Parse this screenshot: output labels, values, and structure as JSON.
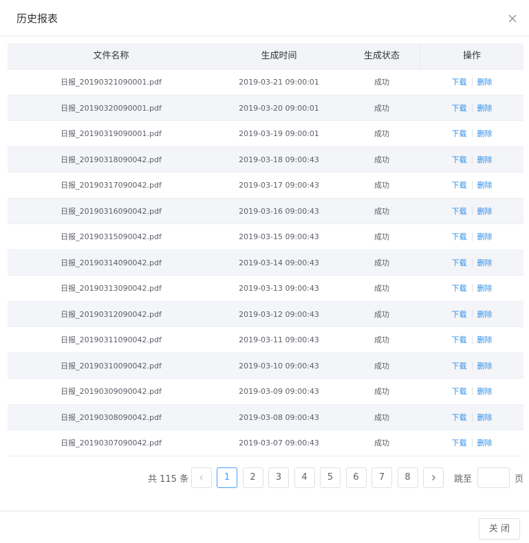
{
  "dialog": {
    "title": "历史报表",
    "close_button_label": "关 闭"
  },
  "table": {
    "columns": [
      "文件名称",
      "生成时间",
      "生成状态",
      "操作"
    ],
    "download_label": "下载",
    "delete_label": "删除",
    "rows": [
      {
        "name": "日报_20190321090001.pdf",
        "time": "2019-03-21 09:00:01",
        "status": "成功"
      },
      {
        "name": "日报_20190320090001.pdf",
        "time": "2019-03-20 09:00:01",
        "status": "成功"
      },
      {
        "name": "日报_20190319090001.pdf",
        "time": "2019-03-19 09:00:01",
        "status": "成功"
      },
      {
        "name": "日报_20190318090042.pdf",
        "time": "2019-03-18 09:00:43",
        "status": "成功"
      },
      {
        "name": "日报_20190317090042.pdf",
        "time": "2019-03-17 09:00:43",
        "status": "成功"
      },
      {
        "name": "日报_20190316090042.pdf",
        "time": "2019-03-16 09:00:43",
        "status": "成功"
      },
      {
        "name": "日报_20190315090042.pdf",
        "time": "2019-03-15 09:00:43",
        "status": "成功"
      },
      {
        "name": "日报_20190314090042.pdf",
        "time": "2019-03-14 09:00:43",
        "status": "成功"
      },
      {
        "name": "日报_20190313090042.pdf",
        "time": "2019-03-13 09:00:43",
        "status": "成功"
      },
      {
        "name": "日报_20190312090042.pdf",
        "time": "2019-03-12 09:00:43",
        "status": "成功"
      },
      {
        "name": "日报_20190311090042.pdf",
        "time": "2019-03-11 09:00:43",
        "status": "成功"
      },
      {
        "name": "日报_20190310090042.pdf",
        "time": "2019-03-10 09:00:43",
        "status": "成功"
      },
      {
        "name": "日报_20190309090042.pdf",
        "time": "2019-03-09 09:00:43",
        "status": "成功"
      },
      {
        "name": "日报_20190308090042.pdf",
        "time": "2019-03-08 09:00:43",
        "status": "成功"
      },
      {
        "name": "日报_20190307090042.pdf",
        "time": "2019-03-07 09:00:43",
        "status": "成功"
      }
    ]
  },
  "pagination": {
    "total_text": "共 115 条",
    "pages": [
      "1",
      "2",
      "3",
      "4",
      "5",
      "6",
      "7",
      "8"
    ],
    "current_page": "1",
    "jump_label": "跳至",
    "jump_value": "",
    "jump_suffix": "页"
  },
  "colors": {
    "link": "#2f8fe8",
    "active_page": "#409eff",
    "header_bg": "#f2f4f8",
    "stripe_bg": "#f4f5f9"
  },
  "icons": {
    "close": "close-icon",
    "prev": "chevron-left-icon",
    "next": "chevron-right-icon"
  }
}
